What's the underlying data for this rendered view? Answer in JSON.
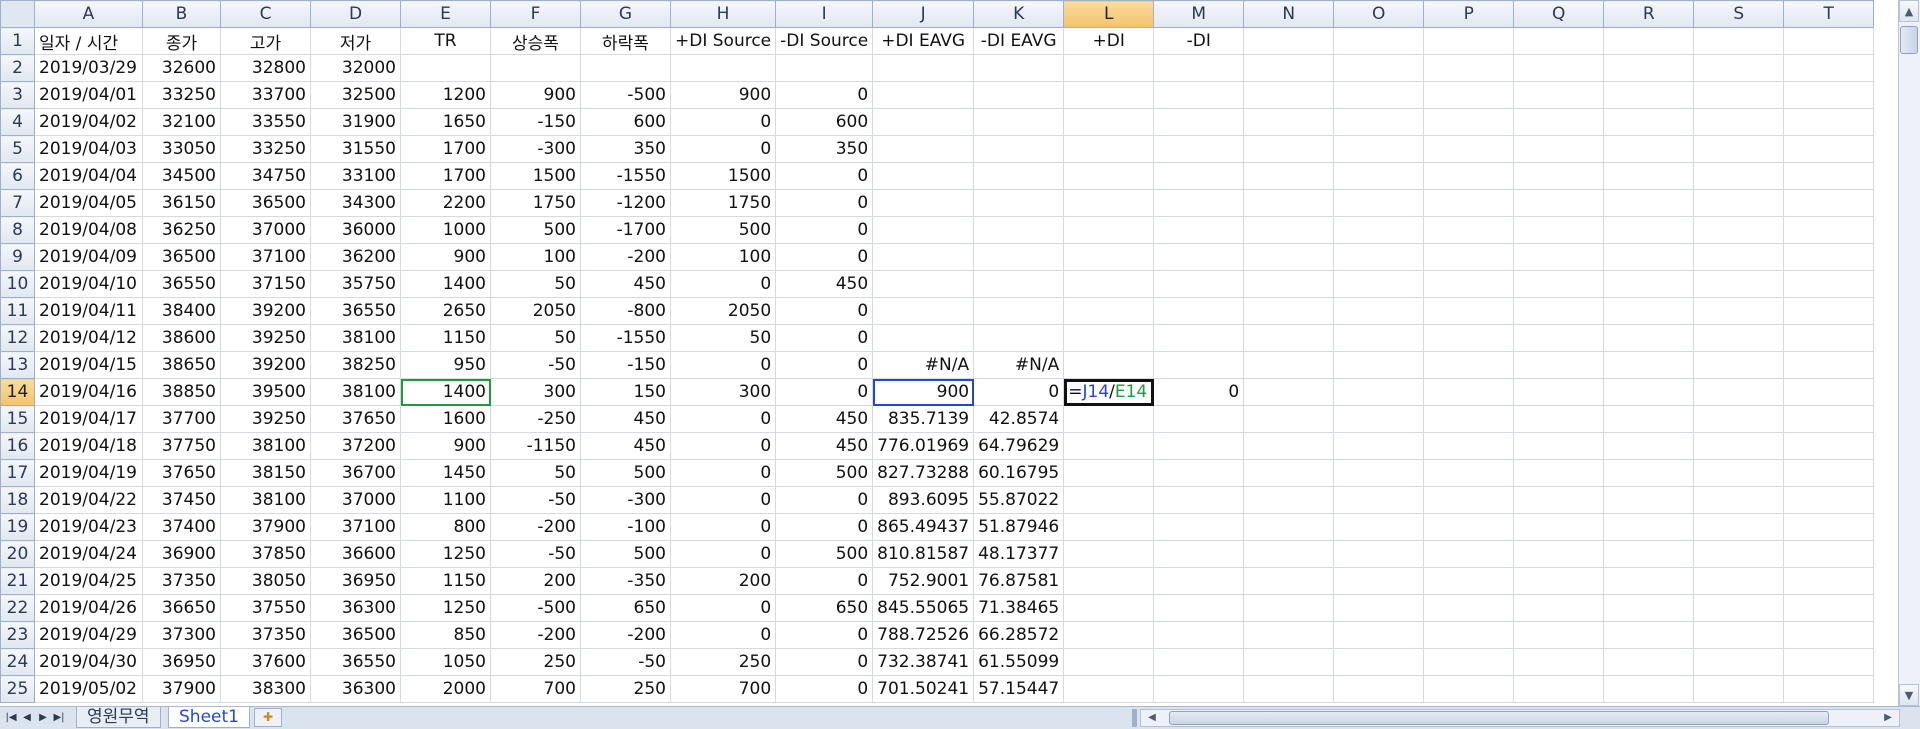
{
  "columns": [
    "A",
    "B",
    "C",
    "D",
    "E",
    "F",
    "G",
    "H",
    "I",
    "J",
    "K",
    "L",
    "M",
    "N",
    "O",
    "P",
    "Q",
    "R",
    "S",
    "T"
  ],
  "headers": [
    "일자 / 시간",
    "종가",
    "고가",
    "저가",
    "TR",
    "상승폭",
    "하락폭",
    "+DI Source",
    "-DI Source",
    "+DI EAVG",
    "-DI EAVG",
    "+DI",
    "-DI"
  ],
  "rows": [
    [
      "2019/03/29",
      "32600",
      "32800",
      "32000",
      "",
      "",
      "",
      "",
      "",
      "",
      "",
      "",
      ""
    ],
    [
      "2019/04/01",
      "33250",
      "33700",
      "32500",
      "1200",
      "900",
      "-500",
      "900",
      "0",
      "",
      "",
      "",
      ""
    ],
    [
      "2019/04/02",
      "32100",
      "33550",
      "31900",
      "1650",
      "-150",
      "600",
      "0",
      "600",
      "",
      "",
      "",
      ""
    ],
    [
      "2019/04/03",
      "33050",
      "33250",
      "31550",
      "1700",
      "-300",
      "350",
      "0",
      "350",
      "",
      "",
      "",
      ""
    ],
    [
      "2019/04/04",
      "34500",
      "34750",
      "33100",
      "1700",
      "1500",
      "-1550",
      "1500",
      "0",
      "",
      "",
      "",
      ""
    ],
    [
      "2019/04/05",
      "36150",
      "36500",
      "34300",
      "2200",
      "1750",
      "-1200",
      "1750",
      "0",
      "",
      "",
      "",
      ""
    ],
    [
      "2019/04/08",
      "36250",
      "37000",
      "36000",
      "1000",
      "500",
      "-1700",
      "500",
      "0",
      "",
      "",
      "",
      ""
    ],
    [
      "2019/04/09",
      "36500",
      "37100",
      "36200",
      "900",
      "100",
      "-200",
      "100",
      "0",
      "",
      "",
      "",
      ""
    ],
    [
      "2019/04/10",
      "36550",
      "37150",
      "35750",
      "1400",
      "50",
      "450",
      "0",
      "450",
      "",
      "",
      "",
      ""
    ],
    [
      "2019/04/11",
      "38400",
      "39200",
      "36550",
      "2650",
      "2050",
      "-800",
      "2050",
      "0",
      "",
      "",
      "",
      ""
    ],
    [
      "2019/04/12",
      "38600",
      "39250",
      "38100",
      "1150",
      "50",
      "-1550",
      "50",
      "0",
      "",
      "",
      "",
      ""
    ],
    [
      "2019/04/15",
      "38650",
      "39200",
      "38250",
      "950",
      "-50",
      "-150",
      "0",
      "0",
      "#N/A",
      "#N/A",
      "",
      ""
    ],
    [
      "2019/04/16",
      "38850",
      "39500",
      "38100",
      "1400",
      "300",
      "150",
      "300",
      "0",
      "900",
      "0",
      "",
      "0"
    ],
    [
      "2019/04/17",
      "37700",
      "39250",
      "37650",
      "1600",
      "-250",
      "450",
      "0",
      "450",
      "835.7139",
      "42.8574",
      "",
      ""
    ],
    [
      "2019/04/18",
      "37750",
      "38100",
      "37200",
      "900",
      "-1150",
      "450",
      "0",
      "450",
      "776.01969",
      "64.79629",
      "",
      ""
    ],
    [
      "2019/04/19",
      "37650",
      "38150",
      "36700",
      "1450",
      "50",
      "500",
      "0",
      "500",
      "827.73288",
      "60.16795",
      "",
      ""
    ],
    [
      "2019/04/22",
      "37450",
      "38100",
      "37000",
      "1100",
      "-50",
      "-300",
      "0",
      "0",
      "893.6095",
      "55.87022",
      "",
      ""
    ],
    [
      "2019/04/23",
      "37400",
      "37900",
      "37100",
      "800",
      "-200",
      "-100",
      "0",
      "0",
      "865.49437",
      "51.87946",
      "",
      ""
    ],
    [
      "2019/04/24",
      "36900",
      "37850",
      "36600",
      "1250",
      "-50",
      "500",
      "0",
      "500",
      "810.81587",
      "48.17377",
      "",
      ""
    ],
    [
      "2019/04/25",
      "37350",
      "38050",
      "36950",
      "1150",
      "200",
      "-350",
      "200",
      "0",
      "752.9001",
      "76.87581",
      "",
      ""
    ],
    [
      "2019/04/26",
      "36650",
      "37550",
      "36300",
      "1250",
      "-500",
      "650",
      "0",
      "650",
      "845.55065",
      "71.38465",
      "",
      ""
    ],
    [
      "2019/04/29",
      "37300",
      "37350",
      "36500",
      "850",
      "-200",
      "-200",
      "0",
      "0",
      "788.72526",
      "66.28572",
      "",
      ""
    ],
    [
      "2019/04/30",
      "36950",
      "37600",
      "36550",
      "1050",
      "250",
      "-50",
      "250",
      "0",
      "732.38741",
      "61.55099",
      "",
      ""
    ],
    [
      "2019/05/02",
      "37900",
      "38300",
      "36300",
      "2000",
      "700",
      "250",
      "700",
      "0",
      "701.50241",
      "57.15447",
      "",
      ""
    ]
  ],
  "active_cell": {
    "address": "L14",
    "formula_parts": [
      "=",
      "J14",
      "/",
      "E14"
    ]
  },
  "sheet_tabs": [
    "영원무역",
    "Sheet1"
  ],
  "active_tab": "Sheet1",
  "nav_icons": [
    "first-sheet-icon",
    "prev-sheet-icon",
    "next-sheet-icon",
    "last-sheet-icon"
  ]
}
